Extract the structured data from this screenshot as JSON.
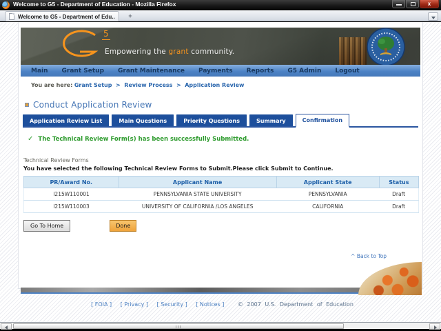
{
  "window": {
    "title": "Welcome to G5 - Department of Education - Mozilla Firefox",
    "tab_title": "Welcome to G5 - Department of Edu...",
    "new_tab_glyph": "+",
    "close_glyph": "x"
  },
  "banner": {
    "logo_number": "5",
    "tagline_pre": "Empowering the",
    "tagline_highlight": "grant",
    "tagline_post": "community."
  },
  "nav": {
    "items": [
      "Main",
      "Grant Setup",
      "Grant Maintenance",
      "Payments",
      "Reports",
      "G5 Admin",
      "Logout"
    ]
  },
  "breadcrumb": {
    "prefix": "You are here:",
    "separator": ">",
    "items": [
      "Grant Setup",
      "Review Process",
      "Application Review"
    ]
  },
  "page": {
    "heading": "Conduct Application Review",
    "tabs": [
      "Application Review List",
      "Main Questions",
      "Priority Questions",
      "Summary",
      "Confirmation"
    ],
    "success_icon": "✓",
    "success_message": "The Technical Review Form(s) has been successfully Submitted.",
    "section_label": "Technical Review Forms",
    "instruction": "You have selected the following Technical Review Forms to Submit.Please click Submit to Continue.",
    "table": {
      "headers": [
        "PR/Award No.",
        "Applicant Name",
        "Applicant State",
        "Status"
      ],
      "rows": [
        [
          "I215W110001",
          "PENNSYLVANIA STATE UNIVERSITY",
          "PENNSYLVANIA",
          "Draft"
        ],
        [
          "I215W110003",
          "UNIVERSITY OF CALIFORNIA /LOS ANGELES",
          "CALIFORNIA",
          "Draft"
        ]
      ]
    },
    "go_home_button": "Go To Home",
    "done_button": "Done",
    "back_to_top": "^ Back to Top"
  },
  "footer": {
    "links": [
      "[ FOIA ]",
      "[ Privacy ]",
      "[ Security ]",
      "[ Notices ]"
    ],
    "copyright": "© 2007 U.S. Department of Education"
  },
  "colors": {
    "nav_bar_blue": "#4d83c5",
    "nav_text_navy": "#17375e",
    "tab_blue": "#1d4f9c",
    "success_green": "#2e9b2e",
    "link_blue": "#4a7fc1",
    "table_header_bg": "#d9eaf5",
    "table_header_text": "#1d5fa8",
    "logo_orange": "#f7941d",
    "done_button_orange": "#efa33a",
    "banner_dark": "#474b42"
  }
}
